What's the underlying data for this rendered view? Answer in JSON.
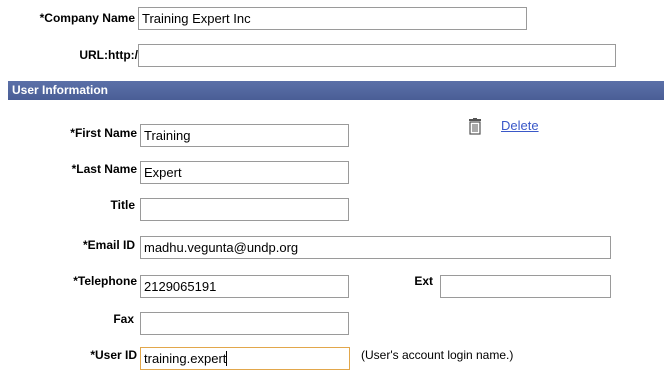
{
  "company": {
    "label": "*Company Name",
    "value": "Training Expert Inc"
  },
  "url": {
    "label": "URL:",
    "prefix": "http://",
    "value": ""
  },
  "section": {
    "title": "User Information"
  },
  "delete": {
    "label": "Delete",
    "icon": "trash-icon"
  },
  "first_name": {
    "label": "*First Name",
    "value": "Training"
  },
  "last_name": {
    "label": "*Last Name",
    "value": "Expert"
  },
  "title": {
    "label": "Title",
    "value": ""
  },
  "email": {
    "label": "*Email ID",
    "value": "madhu.vegunta@undp.org"
  },
  "telephone": {
    "label": "*Telephone",
    "value": "2129065191"
  },
  "ext": {
    "label": "Ext",
    "value": ""
  },
  "fax": {
    "label": "Fax",
    "value": ""
  },
  "user_id": {
    "label": "*User ID",
    "value": "training.expert",
    "hint": "(User's account login name.)"
  },
  "colors": {
    "section_bar": "#4a5e96",
    "link": "#3a58c8",
    "focus_border": "#e2a74b"
  }
}
